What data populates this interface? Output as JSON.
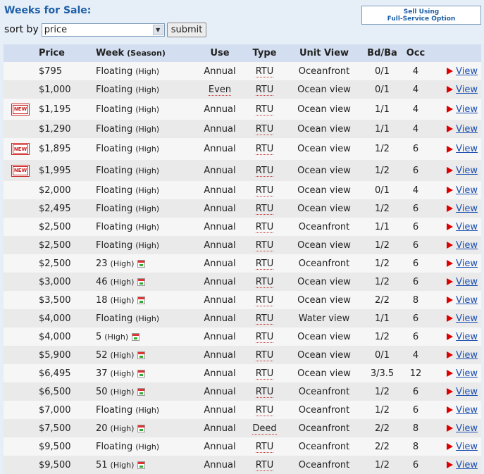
{
  "page": {
    "title": "Weeks for Sale:",
    "sort_label": "sort by",
    "sort_selected": "price",
    "submit_label": "submit",
    "full_service_line1": "Sell Using",
    "full_service_line2": "Full-Service Option"
  },
  "headers": {
    "price": "Price",
    "week": "Week",
    "season": "(Season)",
    "use": "Use",
    "type": "Type",
    "unit_view": "Unit View",
    "bdba": "Bd/Ba",
    "occ": "Occ"
  },
  "new_badge_text": "NEW",
  "view_label": "View",
  "colors": {
    "accent": "#1d5fa8",
    "header_bg": "#d3dff0",
    "new_red": "#cc2222",
    "arrow_red": "#dd0000"
  },
  "rows": [
    {
      "new": false,
      "price": "$795",
      "week": "Floating",
      "season": "(High)",
      "cal": false,
      "use": "Annual",
      "use_dotted": false,
      "type": "RTU",
      "view": "Oceanfront",
      "bdba": "0/1",
      "occ": "4",
      "h": 26
    },
    {
      "new": false,
      "price": "$1,000",
      "week": "Floating",
      "season": "(High)",
      "cal": false,
      "use": "Even",
      "use_dotted": true,
      "type": "RTU",
      "view": "Ocean view",
      "bdba": "0/1",
      "occ": "4",
      "h": 26
    },
    {
      "new": true,
      "price": "$1,195",
      "week": "Floating",
      "season": "(High)",
      "cal": false,
      "use": "Annual",
      "use_dotted": false,
      "type": "RTU",
      "view": "Ocean view",
      "bdba": "1/1",
      "occ": "4",
      "h": 30
    },
    {
      "new": false,
      "price": "$1,290",
      "week": "Floating",
      "season": "(High)",
      "cal": false,
      "use": "Annual",
      "use_dotted": false,
      "type": "RTU",
      "view": "Ocean view",
      "bdba": "1/1",
      "occ": "4",
      "h": 26
    },
    {
      "new": true,
      "price": "$1,895",
      "week": "Floating",
      "season": "(High)",
      "cal": false,
      "use": "Annual",
      "use_dotted": false,
      "type": "RTU",
      "view": "Ocean view",
      "bdba": "1/2",
      "occ": "6",
      "h": 31
    },
    {
      "new": true,
      "price": "$1,995",
      "week": "Floating",
      "season": "(High)",
      "cal": false,
      "use": "Annual",
      "use_dotted": false,
      "type": "RTU",
      "view": "Ocean view",
      "bdba": "1/2",
      "occ": "6",
      "h": 30
    },
    {
      "new": false,
      "price": "$2,000",
      "week": "Floating",
      "season": "(High)",
      "cal": false,
      "use": "Annual",
      "use_dotted": false,
      "type": "RTU",
      "view": "Ocean view",
      "bdba": "0/1",
      "occ": "4",
      "h": 26
    },
    {
      "new": false,
      "price": "$2,495",
      "week": "Floating",
      "season": "(High)",
      "cal": false,
      "use": "Annual",
      "use_dotted": false,
      "type": "RTU",
      "view": "Ocean view",
      "bdba": "1/2",
      "occ": "6",
      "h": 26
    },
    {
      "new": false,
      "price": "$2,500",
      "week": "Floating",
      "season": "(High)",
      "cal": false,
      "use": "Annual",
      "use_dotted": false,
      "type": "RTU",
      "view": "Oceanfront",
      "bdba": "1/1",
      "occ": "6",
      "h": 26
    },
    {
      "new": false,
      "price": "$2,500",
      "week": "Floating",
      "season": "(High)",
      "cal": false,
      "use": "Annual",
      "use_dotted": false,
      "type": "RTU",
      "view": "Ocean view",
      "bdba": "1/2",
      "occ": "6",
      "h": 26
    },
    {
      "new": false,
      "price": "$2,500",
      "week": "23",
      "season": "(High)",
      "cal": true,
      "use": "Annual",
      "use_dotted": false,
      "type": "RTU",
      "view": "Oceanfront",
      "bdba": "1/2",
      "occ": "6",
      "h": 26
    },
    {
      "new": false,
      "price": "$3,000",
      "week": "46",
      "season": "(High)",
      "cal": true,
      "use": "Annual",
      "use_dotted": false,
      "type": "RTU",
      "view": "Ocean view",
      "bdba": "1/2",
      "occ": "6",
      "h": 26
    },
    {
      "new": false,
      "price": "$3,500",
      "week": "18",
      "season": "(High)",
      "cal": true,
      "use": "Annual",
      "use_dotted": false,
      "type": "RTU",
      "view": "Ocean view",
      "bdba": "2/2",
      "occ": "8",
      "h": 26
    },
    {
      "new": false,
      "price": "$4,000",
      "week": "Floating",
      "season": "(High)",
      "cal": false,
      "use": "Annual",
      "use_dotted": false,
      "type": "RTU",
      "view": "Water view",
      "bdba": "1/1",
      "occ": "6",
      "h": 26
    },
    {
      "new": false,
      "price": "$4,000",
      "week": "5",
      "season": "(High)",
      "cal": true,
      "use": "Annual",
      "use_dotted": false,
      "type": "RTU",
      "view": "Ocean view",
      "bdba": "1/2",
      "occ": "6",
      "h": 26
    },
    {
      "new": false,
      "price": "$5,900",
      "week": "52",
      "season": "(High)",
      "cal": true,
      "use": "Annual",
      "use_dotted": false,
      "type": "RTU",
      "view": "Ocean view",
      "bdba": "0/1",
      "occ": "4",
      "h": 26
    },
    {
      "new": false,
      "price": "$6,495",
      "week": "37",
      "season": "(High)",
      "cal": true,
      "use": "Annual",
      "use_dotted": false,
      "type": "RTU",
      "view": "Ocean view",
      "bdba": "3/3.5",
      "occ": "12",
      "h": 26
    },
    {
      "new": false,
      "price": "$6,500",
      "week": "50",
      "season": "(High)",
      "cal": true,
      "use": "Annual",
      "use_dotted": false,
      "type": "RTU",
      "view": "Oceanfront",
      "bdba": "1/2",
      "occ": "6",
      "h": 26
    },
    {
      "new": false,
      "price": "$7,000",
      "week": "Floating",
      "season": "(High)",
      "cal": false,
      "use": "Annual",
      "use_dotted": false,
      "type": "RTU",
      "view": "Oceanfront",
      "bdba": "1/2",
      "occ": "6",
      "h": 26
    },
    {
      "new": false,
      "price": "$7,500",
      "week": "20",
      "season": "(High)",
      "cal": true,
      "use": "Annual",
      "use_dotted": false,
      "type": "Deed",
      "view": "Oceanfront",
      "bdba": "2/2",
      "occ": "8",
      "h": 26
    },
    {
      "new": false,
      "price": "$9,500",
      "week": "Floating",
      "season": "(High)",
      "cal": false,
      "use": "Annual",
      "use_dotted": false,
      "type": "RTU",
      "view": "Oceanfront",
      "bdba": "2/2",
      "occ": "8",
      "h": 26
    },
    {
      "new": false,
      "price": "$9,500",
      "week": "51",
      "season": "(High)",
      "cal": true,
      "use": "Annual",
      "use_dotted": false,
      "type": "RTU",
      "view": "Oceanfront",
      "bdba": "1/2",
      "occ": "6",
      "h": 26
    }
  ]
}
